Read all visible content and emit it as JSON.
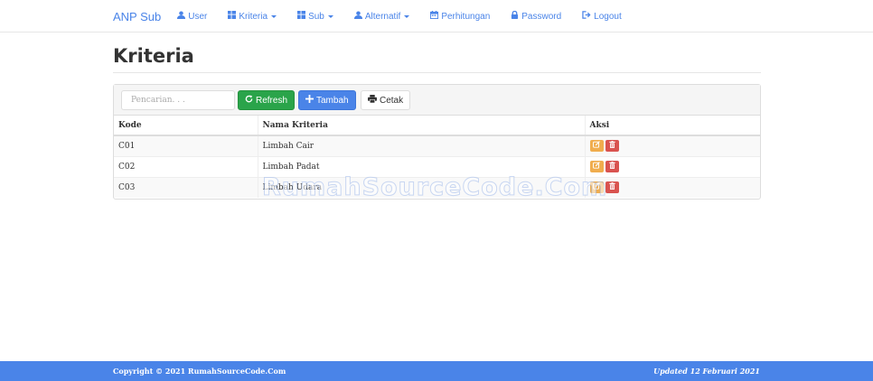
{
  "navbar": {
    "brand": "ANP Sub",
    "items": [
      {
        "label": "User",
        "icon": "user-icon",
        "dropdown": false
      },
      {
        "label": "Kriteria",
        "icon": "grid-icon",
        "dropdown": true
      },
      {
        "label": "Sub",
        "icon": "grid-icon",
        "dropdown": true
      },
      {
        "label": "Alternatif",
        "icon": "user-icon",
        "dropdown": true
      },
      {
        "label": "Perhitungan",
        "icon": "calendar-icon",
        "dropdown": false
      },
      {
        "label": "Password",
        "icon": "lock-icon",
        "dropdown": false
      },
      {
        "label": "Logout",
        "icon": "logout-icon",
        "dropdown": false
      }
    ]
  },
  "page": {
    "title": "Kriteria"
  },
  "toolbar": {
    "search_placeholder": "Pencarian. . .",
    "refresh_label": "Refresh",
    "tambah_label": "Tambah",
    "cetak_label": "Cetak"
  },
  "table": {
    "headers": [
      "Kode",
      "Nama Kriteria",
      "Aksi"
    ],
    "rows": [
      {
        "kode": "C01",
        "nama": "Limbah Cair"
      },
      {
        "kode": "C02",
        "nama": "Limbah Padat"
      },
      {
        "kode": "C03",
        "nama": "Limbah Udara"
      }
    ]
  },
  "watermark": "RumahSourceCode.Com",
  "footer": {
    "copyright": "Copyright © 2021 RumahSourceCode.Com",
    "updated": "Updated 12 Februari 2021"
  },
  "colors": {
    "primary": "#4a84e8",
    "success": "#2aa44a",
    "warning": "#f0ad4e",
    "danger": "#d9534f"
  }
}
